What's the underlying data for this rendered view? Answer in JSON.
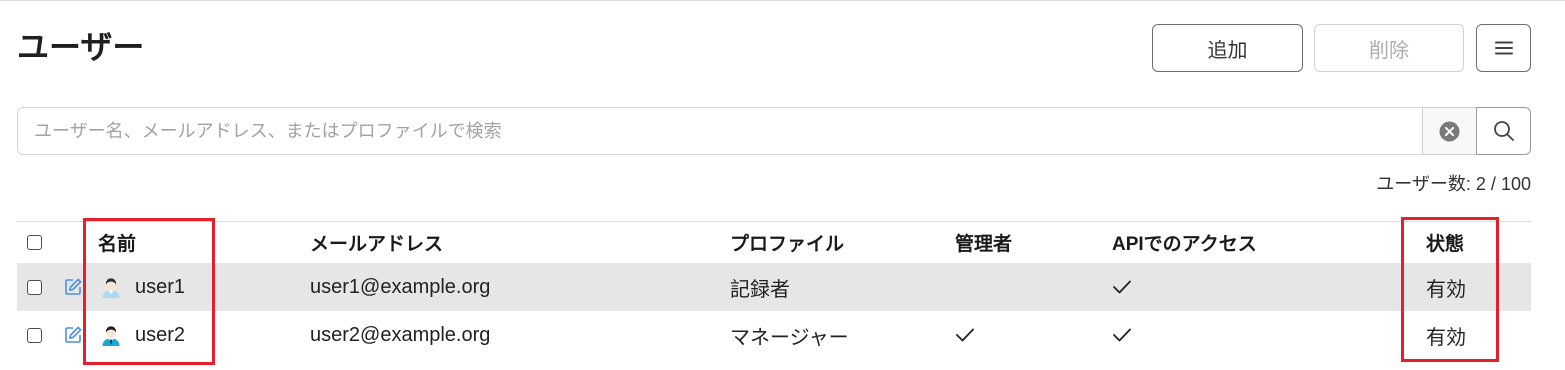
{
  "page": {
    "title": "ユーザー"
  },
  "toolbar": {
    "add": {
      "label": "追加",
      "enabled": true
    },
    "delete": {
      "label": "削除",
      "enabled": false
    },
    "menu": {
      "icon": "hamburger-menu-icon"
    }
  },
  "search": {
    "placeholder": "ユーザー名、メールアドレス、またはプロファイルで検索",
    "value": "",
    "clear_icon": "clear-circle-icon",
    "submit_icon": "search-icon"
  },
  "summary": {
    "count_label": "ユーザー数:",
    "count": 2,
    "separator": "/",
    "limit": 100
  },
  "table": {
    "select_all": false,
    "edit_icon": "edit-icon",
    "check_icon": "check-icon",
    "columns": [
      "名前",
      "メールアドレス",
      "プロファイル",
      "管理者",
      "APIでのアクセス",
      "状態"
    ],
    "rows": [
      {
        "selected": false,
        "avatar_icon": "user-avatar-icon",
        "name": "user1",
        "email": "user1@example.org",
        "profile": "記録者",
        "admin": false,
        "api_access": true,
        "status": "有効"
      },
      {
        "selected": false,
        "avatar_icon": "manager-avatar-icon",
        "name": "user2",
        "email": "user2@example.org",
        "profile": "マネージャー",
        "admin": true,
        "api_access": true,
        "status": "有効"
      }
    ]
  },
  "colors": {
    "text": "#222222",
    "muted": "#a3a3a3",
    "accent": "#4a90e2",
    "border": "#d6d6d6",
    "row_hover": "#e6e6e6",
    "highlight": "#e3202c"
  }
}
